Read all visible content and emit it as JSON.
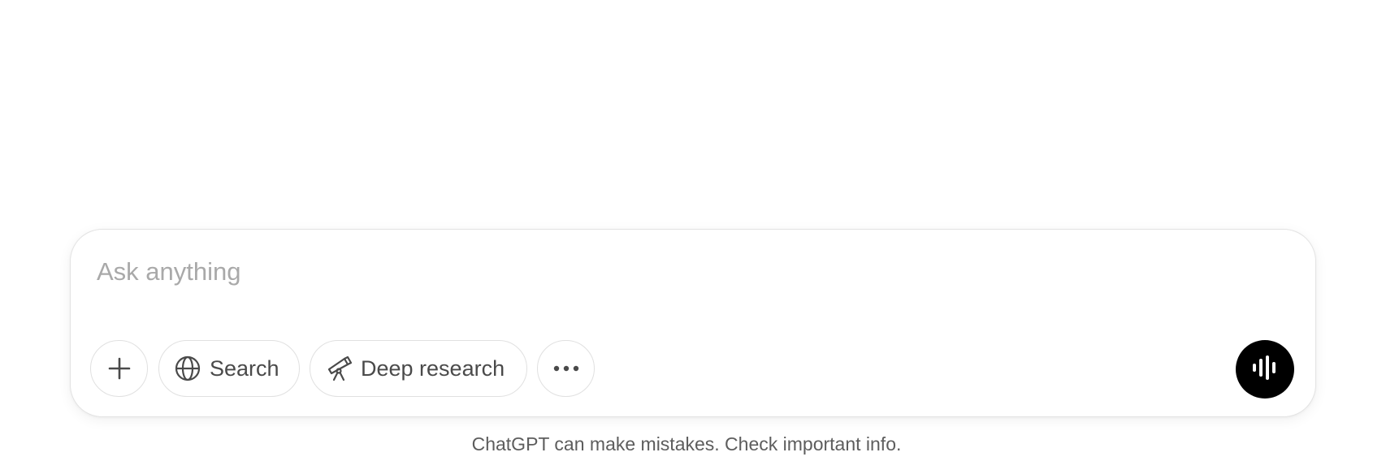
{
  "composer": {
    "placeholder": "Ask anything",
    "value": ""
  },
  "toolbar": {
    "attach_icon": "plus-icon",
    "search_label": "Search",
    "search_icon": "globe-icon",
    "deep_research_label": "Deep research",
    "deep_research_icon": "telescope-icon",
    "more_icon": "ellipsis-icon",
    "voice_icon": "audio-waveform-icon"
  },
  "footer": {
    "disclaimer": "ChatGPT can make mistakes. Check important info."
  },
  "colors": {
    "voice_button_bg": "#000000",
    "placeholder": "#a9a9a9",
    "pill_border": "#e0e0e0",
    "text": "#4a4a4a"
  }
}
